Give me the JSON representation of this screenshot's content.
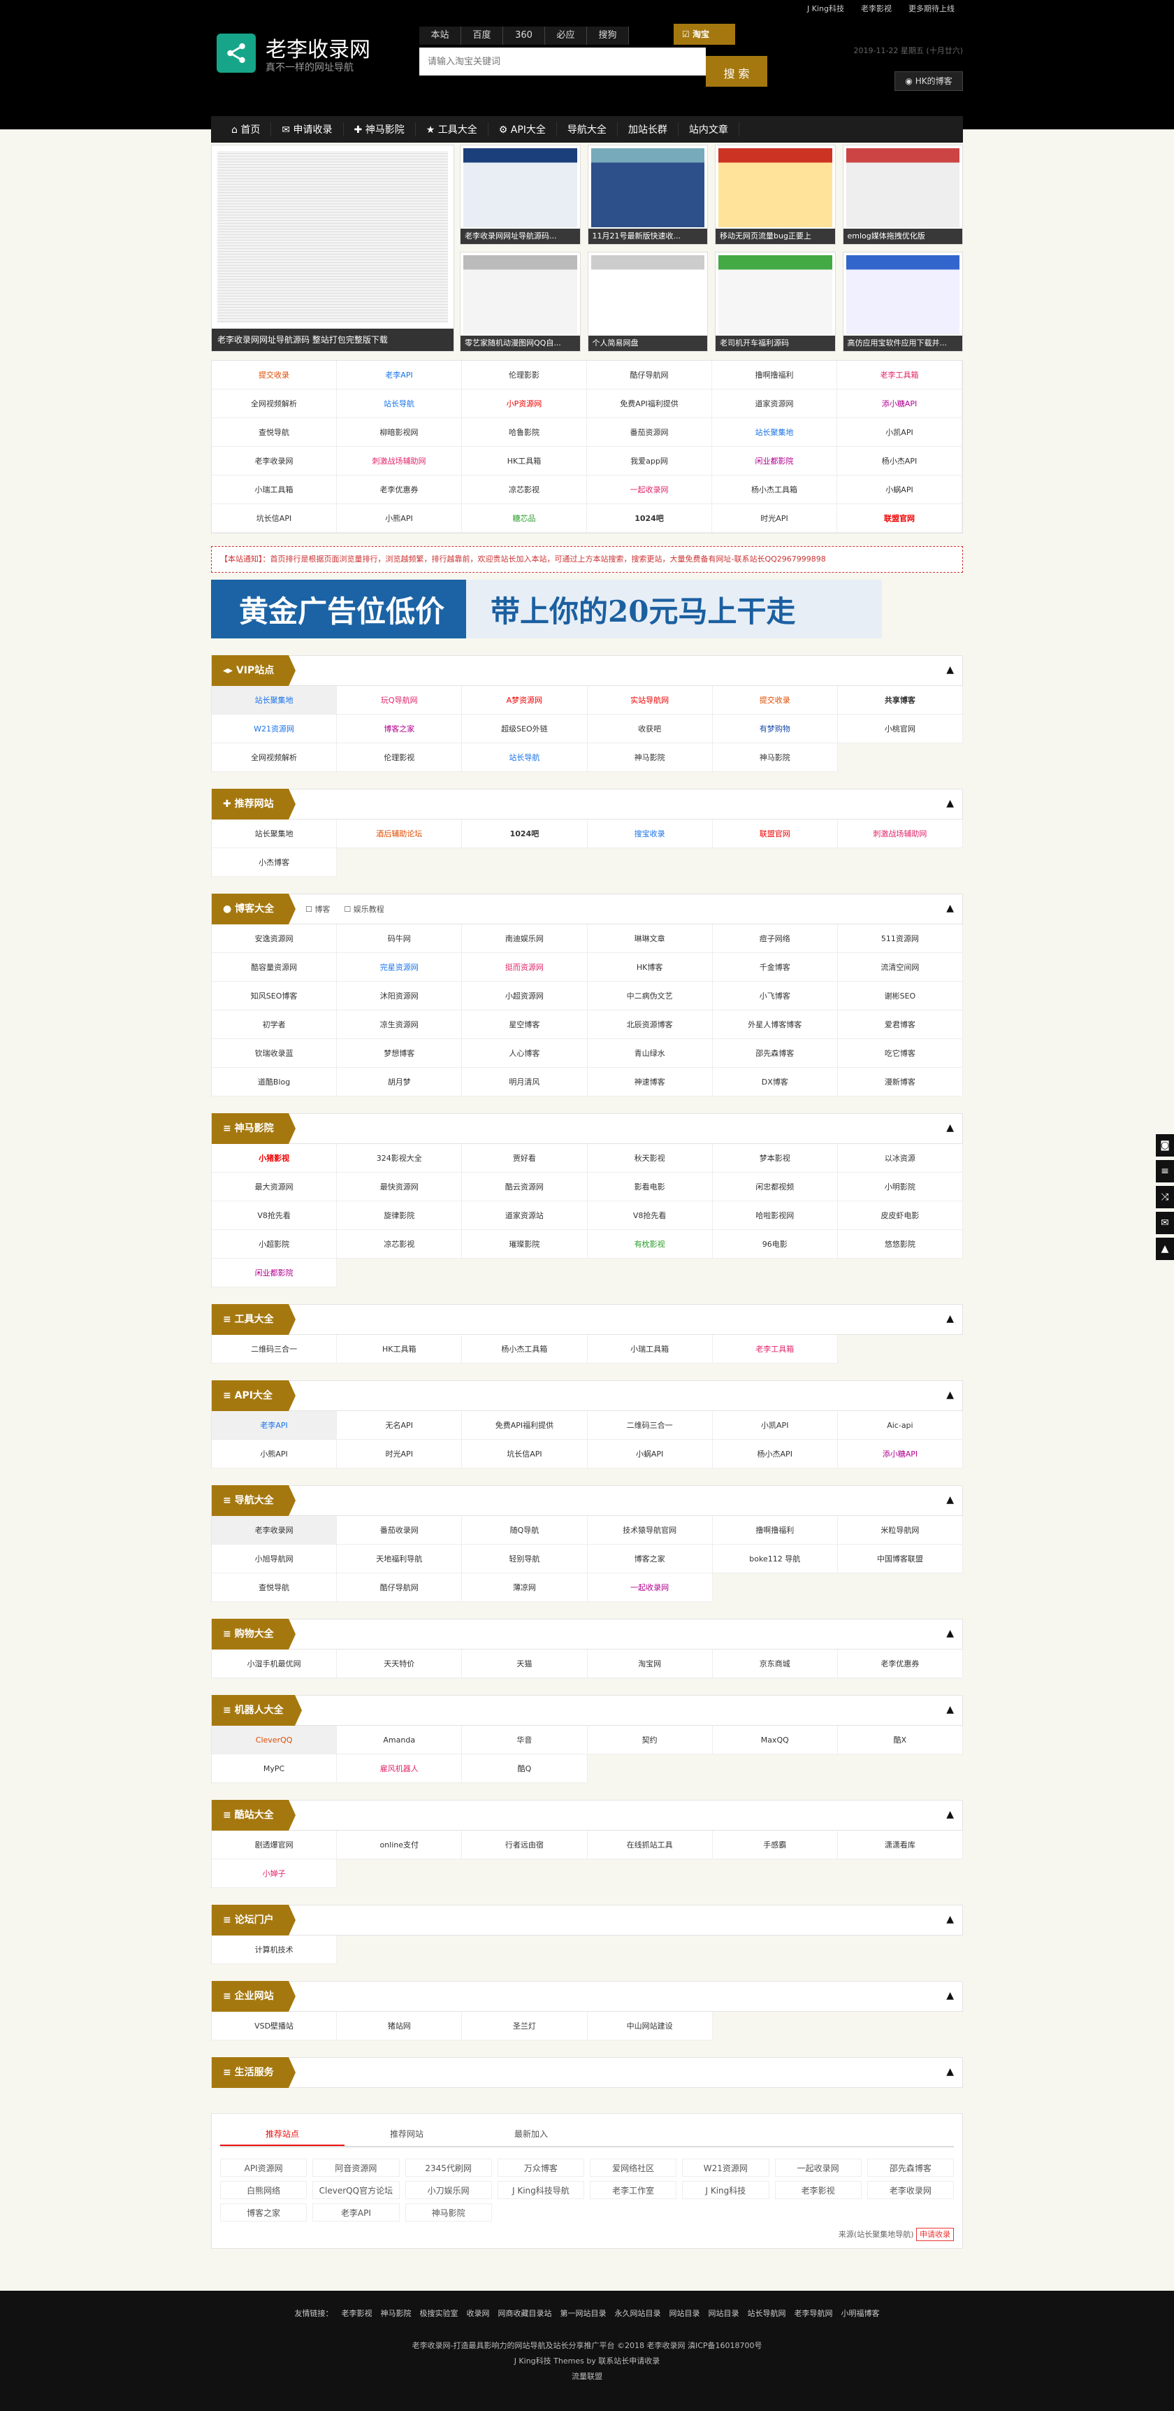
{
  "top_links": [
    "J King科技",
    "老李影视",
    "更多期待上线"
  ],
  "site": {
    "title": "老李收录网",
    "subtitle": "真不一样的网址导航"
  },
  "search": {
    "tabs": [
      "本站",
      "百度",
      "360",
      "必应",
      "搜狗"
    ],
    "taobao": "淘宝",
    "placeholder": "请输入淘宝关键词",
    "button": "搜 索"
  },
  "date": "2019-11-22 星期五 (十月廿六)",
  "user_button": "HK的博客",
  "nav": [
    "首页",
    "申请收录",
    "神马影院",
    "工具大全",
    "API大全",
    "导航大全",
    "加站长群",
    "站内文章"
  ],
  "hero": {
    "main_caption": "老李收录网网址导航源码 整站打包完整版下载",
    "thumbs": [
      "老李收录网网址导航源码...",
      "11月21号最新版快速收...",
      "移动无网页流量bug正要上",
      "emlog媒体拖拽优化版",
      "零艺家随机动漫图网QQ自...",
      "个人简易网盘",
      "老司机开车福利源码",
      "高仿应用宝软件应用下载并..."
    ]
  },
  "quick_links": [
    {
      "t": "提交收录",
      "c": "#e04b00"
    },
    {
      "t": "老李API",
      "c": "#1a73e8"
    },
    {
      "t": "伦理影影"
    },
    {
      "t": "酷仔导航网"
    },
    {
      "t": "撸啊撸福利"
    },
    {
      "t": "老李工具箱",
      "c": "#e0266a"
    },
    {
      "t": "全网视频解析"
    },
    {
      "t": "站长导航",
      "c": "#1a73e8"
    },
    {
      "t": "小P资源网",
      "c": "#e00"
    },
    {
      "t": "免费API福利提供"
    },
    {
      "t": "道家资源网"
    },
    {
      "t": "添小糖API",
      "c": "#b0008f"
    },
    {
      "t": "查悦导航"
    },
    {
      "t": "柳暗影视网"
    },
    {
      "t": "哈鲁影院"
    },
    {
      "t": "番茄资源网"
    },
    {
      "t": "站长聚集地",
      "c": "#1a73e8"
    },
    {
      "t": "小凯API"
    },
    {
      "t": "老李收录网"
    },
    {
      "t": "刺激战场辅助网",
      "c": "#e0266a"
    },
    {
      "t": "HK工具箱"
    },
    {
      "t": "我爱app网"
    },
    {
      "t": "闲业都影院",
      "c": "#b0008f"
    },
    {
      "t": "杨小杰API"
    },
    {
      "t": "小瑞工具箱"
    },
    {
      "t": "老李优惠券"
    },
    {
      "t": "凉芯影视"
    },
    {
      "t": "一起收录网",
      "c": "#e0266a"
    },
    {
      "t": "杨小杰工具箱"
    },
    {
      "t": "小蜗API"
    },
    {
      "t": "坑长信API"
    },
    {
      "t": "小熊API"
    },
    {
      "t": "糖芯品",
      "c": "#2a9d2a"
    },
    {
      "t": "1024吧",
      "b": true
    },
    {
      "t": "时光API"
    },
    {
      "t": "联盟官网",
      "c": "#e00",
      "b": true
    }
  ],
  "notice": "【本站通知】：首页排行是根据页面浏览量排行，浏览越频繁，排行越靠前，欢迎贵站长加入本站，可通过上方本站搜索，搜索更站，大量免费备有网址-联系站长QQ2967999898",
  "banner": {
    "left": "黄金广告位低价",
    "right": "带上你的20元马上干走"
  },
  "sections": [
    {
      "title": "VIP站点",
      "icon": "◂▸",
      "items": [
        {
          "t": "站长聚集地",
          "c": "#1a73e8",
          "a": true
        },
        {
          "t": "玩Q导航网",
          "c": "#e0266a"
        },
        {
          "t": "A梦资源网",
          "c": "#e00"
        },
        {
          "t": "实站导航网",
          "c": "#e00"
        },
        {
          "t": "提交收录",
          "c": "#e04b00"
        },
        {
          "t": "共享博客",
          "b": true
        },
        {
          "t": "W21资源网",
          "c": "#1a73e8"
        },
        {
          "t": "博客之家",
          "c": "#b0008f"
        },
        {
          "t": "超级SEO外链"
        },
        {
          "t": "收获吧"
        },
        {
          "t": "有梦购物",
          "c": "#1a4aa8"
        },
        {
          "t": "小桃官网"
        },
        {
          "t": "全网视频解析"
        },
        {
          "t": "伦理影视"
        },
        {
          "t": "站长导航",
          "c": "#1a73e8"
        },
        {
          "t": "神马影院"
        },
        {
          "t": "神马影院"
        }
      ]
    },
    {
      "title": "推荐网站",
      "icon": "✚",
      "items": [
        {
          "t": "站长聚集地"
        },
        {
          "t": "酒后辅助论坛",
          "c": "#e04b00"
        },
        {
          "t": "1024吧",
          "b": true
        },
        {
          "t": "搜宝收录",
          "c": "#1a73e8"
        },
        {
          "t": "联盟官网",
          "c": "#e00"
        },
        {
          "t": "刺激战场辅助网",
          "c": "#e0266a"
        },
        {
          "t": "小杰博客"
        }
      ]
    },
    {
      "title": "博客大全",
      "icon": "●",
      "subtabs": [
        "博客",
        "娱乐教程"
      ],
      "items": [
        {
          "t": "安逸资源网"
        },
        {
          "t": "码牛网"
        },
        {
          "t": "南迪娱乐网"
        },
        {
          "t": "琳琳文章"
        },
        {
          "t": "痘子网络"
        },
        {
          "t": "511资源网"
        },
        {
          "t": "酷容量资源网"
        },
        {
          "t": "完星资源网",
          "c": "#1a73e8"
        },
        {
          "t": "挺而资源网",
          "c": "#e0266a"
        },
        {
          "t": "HK博客"
        },
        {
          "t": "千金博客"
        },
        {
          "t": "流清空间网"
        },
        {
          "t": "知风SEO博客"
        },
        {
          "t": "沐阳资源网"
        },
        {
          "t": "小超资源网"
        },
        {
          "t": "中二病伪文艺"
        },
        {
          "t": "小飞博客"
        },
        {
          "t": "谢彬SEO"
        },
        {
          "t": "初学者"
        },
        {
          "t": "凉生资源网"
        },
        {
          "t": "星空博客"
        },
        {
          "t": "北辰资源博客"
        },
        {
          "t": "外星人博客博客"
        },
        {
          "t": "爱君博客"
        },
        {
          "t": "钦瑞收录蓝"
        },
        {
          "t": "梦想博客"
        },
        {
          "t": "人心博客"
        },
        {
          "t": "青山绿水"
        },
        {
          "t": "邵先森博客"
        },
        {
          "t": "吃它博客"
        },
        {
          "t": "道酷Blog"
        },
        {
          "t": "胡月梦"
        },
        {
          "t": "明月清风"
        },
        {
          "t": "神速博客"
        },
        {
          "t": "DX博客"
        },
        {
          "t": "漫新博客"
        }
      ]
    },
    {
      "title": "神马影院",
      "icon": "≡",
      "items": [
        {
          "t": "小猪影视",
          "c": "#e00",
          "b": true
        },
        {
          "t": "324影视大全"
        },
        {
          "t": "贾好看"
        },
        {
          "t": "秋天影视"
        },
        {
          "t": "梦本影视"
        },
        {
          "t": "以冰资源"
        },
        {
          "t": "最大资源网"
        },
        {
          "t": "最快资源网"
        },
        {
          "t": "酷云资源网"
        },
        {
          "t": "影看电影"
        },
        {
          "t": "闲忠都视频"
        },
        {
          "t": "小明影院"
        },
        {
          "t": "V8抢先看"
        },
        {
          "t": "旋律影院"
        },
        {
          "t": "道家资源站"
        },
        {
          "t": "V8抢先看"
        },
        {
          "t": "哈啦影视网"
        },
        {
          "t": "皮皮虾电影"
        },
        {
          "t": "小超影院"
        },
        {
          "t": "凉芯影视"
        },
        {
          "t": "璀璨影院"
        },
        {
          "t": "有枕影视",
          "c": "#2a9d2a"
        },
        {
          "t": "96电影"
        },
        {
          "t": "悠悠影院"
        },
        {
          "t": "闲业都影院",
          "c": "#b0008f"
        }
      ]
    },
    {
      "title": "工具大全",
      "icon": "≡",
      "items": [
        {
          "t": "二维码三合一"
        },
        {
          "t": "HK工具箱"
        },
        {
          "t": "杨小杰工具箱"
        },
        {
          "t": "小瑞工具箱"
        },
        {
          "t": "老李工具箱",
          "c": "#e0266a"
        }
      ]
    },
    {
      "title": "API大全",
      "icon": "≡",
      "items": [
        {
          "t": "老李API",
          "c": "#1a73e8",
          "a": true
        },
        {
          "t": "无名API"
        },
        {
          "t": "免费API福利提供"
        },
        {
          "t": "二维码三合一"
        },
        {
          "t": "小凯API"
        },
        {
          "t": "Aic-api"
        },
        {
          "t": "小熊API"
        },
        {
          "t": "时光API"
        },
        {
          "t": "坑长信API"
        },
        {
          "t": "小蜗API"
        },
        {
          "t": "杨小杰API"
        },
        {
          "t": "添小糖API",
          "c": "#b0008f"
        }
      ]
    },
    {
      "title": "导航大全",
      "icon": "≡",
      "items": [
        {
          "t": "老李收录网",
          "a": true
        },
        {
          "t": "番茄收录网"
        },
        {
          "t": "随Q导航"
        },
        {
          "t": "技术猿导航官网"
        },
        {
          "t": "撸啊撸福利"
        },
        {
          "t": "米粒导航网"
        },
        {
          "t": "小旭导航网"
        },
        {
          "t": "天地福利导航"
        },
        {
          "t": "轻别导航"
        },
        {
          "t": "博客之家"
        },
        {
          "t": "boke112 导航"
        },
        {
          "t": "中国博客联盟"
        },
        {
          "t": "查悦导航"
        },
        {
          "t": "酷仔导航网"
        },
        {
          "t": "薄凉网"
        },
        {
          "t": "一起收录网",
          "c": "#b0008f"
        }
      ]
    },
    {
      "title": "购物大全",
      "icon": "≡",
      "items": [
        {
          "t": "小湿手机最优网"
        },
        {
          "t": "天天特价"
        },
        {
          "t": "天猫"
        },
        {
          "t": "淘宝网"
        },
        {
          "t": "京东商城"
        },
        {
          "t": "老李优惠券"
        }
      ]
    },
    {
      "title": "机器人大全",
      "icon": "≡",
      "items": [
        {
          "t": "CleverQQ",
          "c": "#e04b00",
          "a": true
        },
        {
          "t": "Amanda"
        },
        {
          "t": "华音"
        },
        {
          "t": "契约"
        },
        {
          "t": "MaxQQ"
        },
        {
          "t": "酷X"
        },
        {
          "t": "MyPC"
        },
        {
          "t": "雇风机器人",
          "c": "#e0266a"
        },
        {
          "t": "酷Q"
        }
      ]
    },
    {
      "title": "酷站大全",
      "icon": "≡",
      "items": [
        {
          "t": "剧透爆官网"
        },
        {
          "t": "online支付"
        },
        {
          "t": "行者远由宿"
        },
        {
          "t": "在线抓站工具"
        },
        {
          "t": "手感霸"
        },
        {
          "t": "潇潇看库"
        },
        {
          "t": "小婵子",
          "c": "#e0266a"
        }
      ]
    },
    {
      "title": "论坛门户",
      "icon": "≡",
      "items": [
        {
          "t": "计算机技术"
        }
      ]
    },
    {
      "title": "企业网站",
      "icon": "≡",
      "items": [
        {
          "t": "VSD壁播站"
        },
        {
          "t": "猪站网"
        },
        {
          "t": "圣兰灯"
        },
        {
          "t": "中山网站建设"
        }
      ]
    },
    {
      "title": "生活服务",
      "icon": "≡",
      "items": []
    }
  ],
  "tabbox": {
    "tabs": [
      "推荐站点",
      "推荐网站",
      "最新加入"
    ],
    "items": [
      "API资源网",
      "阿音资源网",
      "2345代刷网",
      "万众博客",
      "爱网络社区",
      "W21资源网",
      "一起收录网",
      "邵先森博客",
      "白熊网络",
      "CleverQQ官方论坛",
      "小刀娱乐网",
      "J King科技导航",
      "老李工作室",
      "J King科技",
      "老李影视",
      "老李收录网",
      "博客之家",
      "老李API",
      "神马影院"
    ],
    "source": "来源(站长聚集地导航)",
    "apply": "申请收录"
  },
  "footer": {
    "label": "友情链接：",
    "links": [
      "老李影视",
      "神马影院",
      "极搜实验室",
      "收录网",
      "网商收藏目录站",
      "第一网站目录",
      "永久网站目录",
      "网站目录",
      "网站目录",
      "站长导航网",
      "老李导航网",
      "小明福博客"
    ],
    "copy1": "老李收录网-打造最具影响力的网站导航及站长分享推广平台 ©2018 老李收录网 滇ICP备16018700号",
    "copy2": "J King科技 Themes by 联系站长申请收录",
    "copy3": "流量联盟"
  }
}
